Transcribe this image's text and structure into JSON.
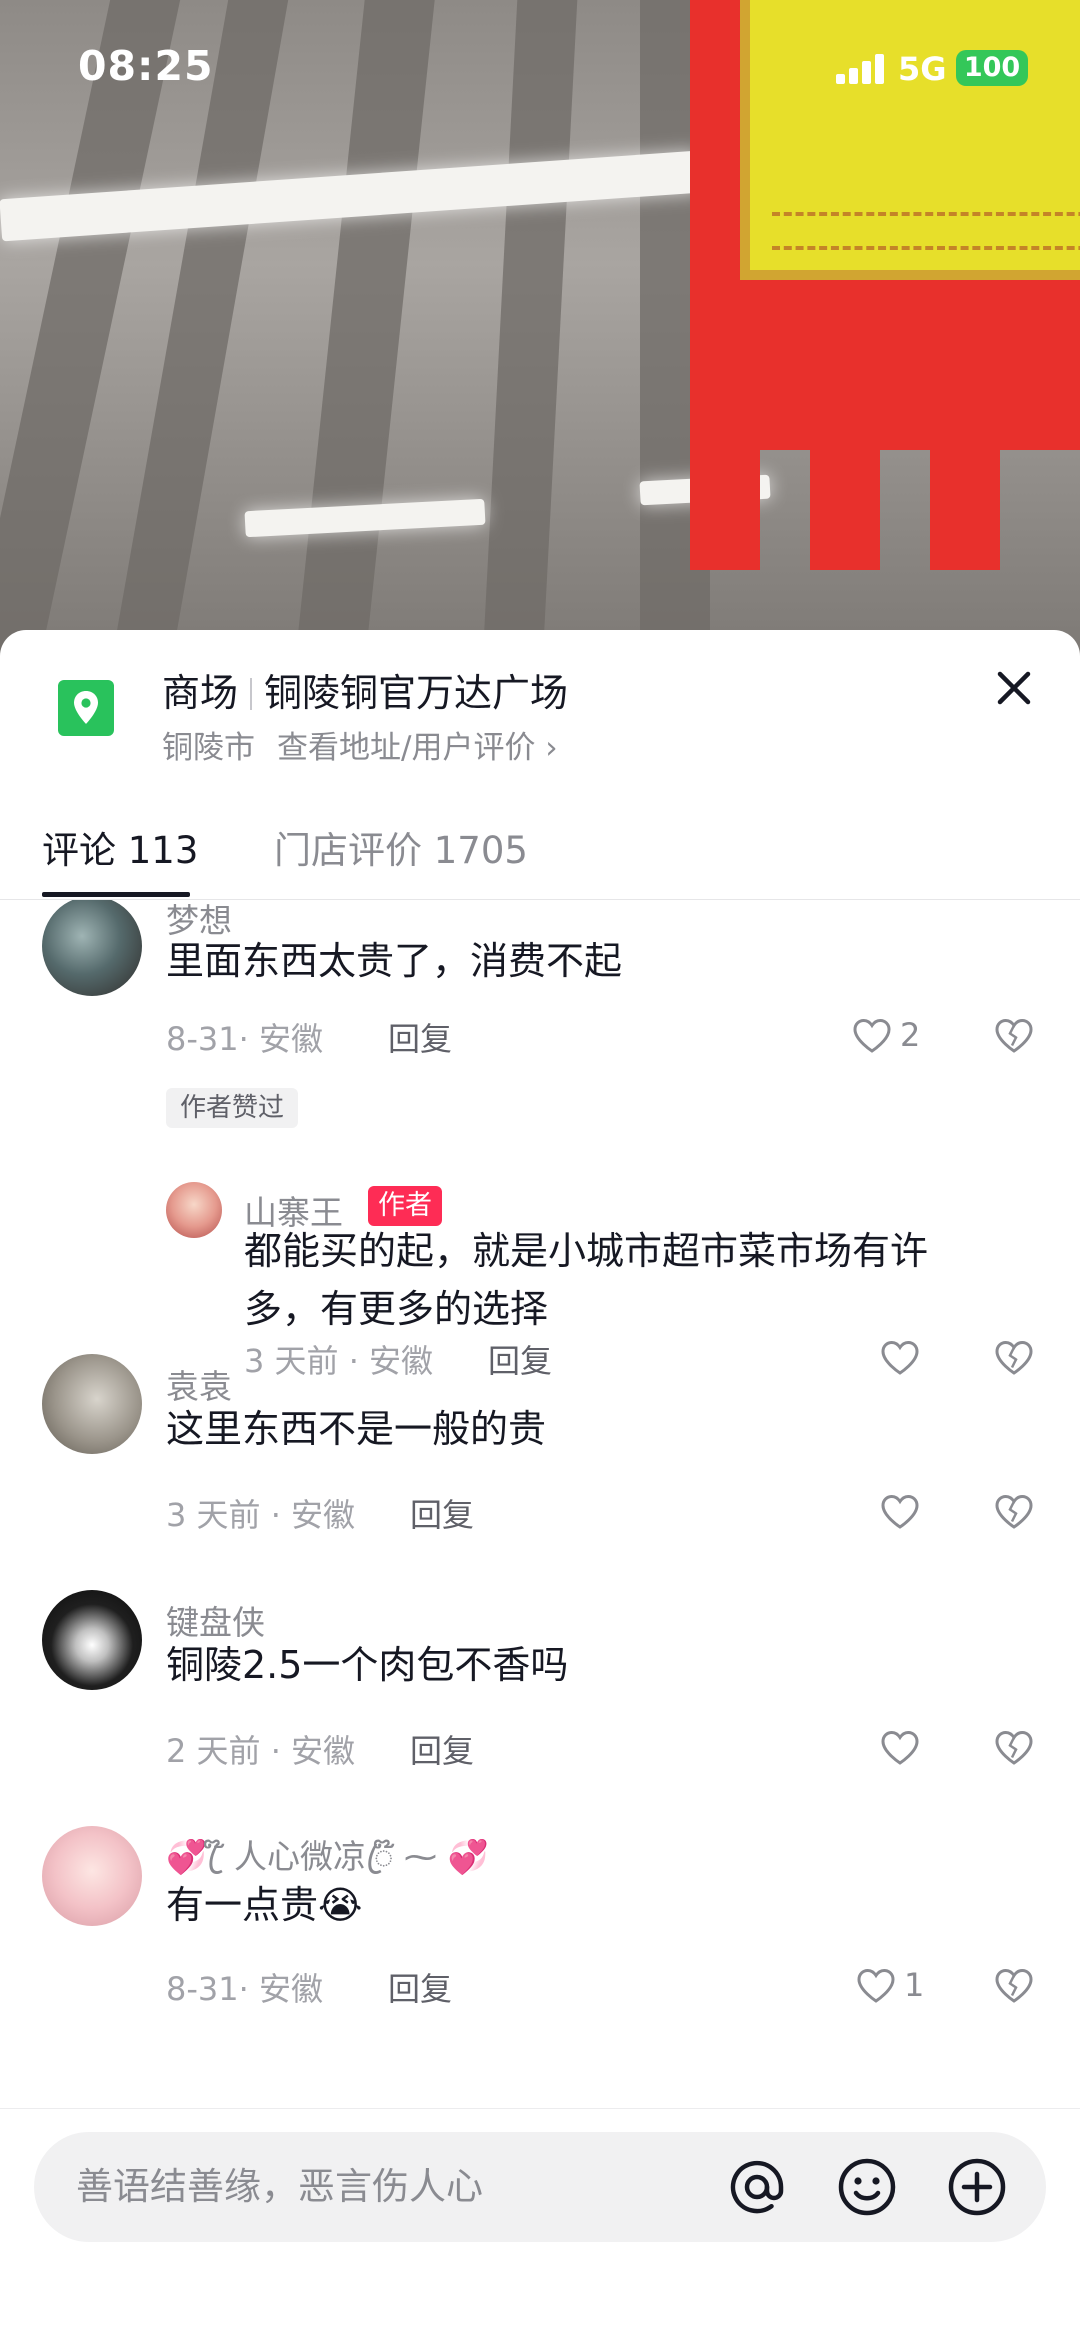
{
  "status_bar": {
    "time": "08:25",
    "network": "5G",
    "battery": "100"
  },
  "location": {
    "category": "商场",
    "name": "铜陵铜官万达广场",
    "city": "铜陵市",
    "link": "查看地址/用户评价 ›"
  },
  "tabs": [
    {
      "label": "评论 113",
      "active": true
    },
    {
      "label": "门店评价 1705",
      "active": false
    }
  ],
  "comments": [
    {
      "user": "梦想",
      "text": "里面东西太贵了，消费不起",
      "meta": "8-31· 安徽",
      "reply_label": "回复",
      "likes": "2",
      "badge": "作者赞过",
      "replies": [
        {
          "user": "山寨王",
          "author_tag": "作者",
          "text_line1": "都能买的起，就是小城市超市菜市场有许",
          "text_line2": "多，有更多的选择",
          "meta": "3 天前 · 安徽",
          "reply_label": "回复"
        }
      ]
    },
    {
      "user": "袁袁",
      "text": "这里东西不是一般的贵",
      "meta": "3 天前 · 安徽",
      "reply_label": "回复"
    },
    {
      "user": "键盘侠",
      "text": "铜陵2.5一个肉包不香吗",
      "meta": "2 天前 · 安徽",
      "reply_label": "回复"
    },
    {
      "user": "💞 ꦿ໊ 人心微凉ꦿ໊ ⁓ 💞",
      "text": "有一点贵😭",
      "meta": "8-31· 安徽",
      "reply_label": "回复",
      "likes": "1"
    }
  ],
  "input": {
    "placeholder": "善语结善缘，恶言伤人心"
  },
  "icons": [
    "location-pin-icon",
    "close-icon",
    "heart-icon",
    "dislike-heart-icon",
    "at-icon",
    "emoji-icon",
    "plus-icon"
  ],
  "colors": {
    "accent_red": "#fe2c55",
    "location_green": "#29c25c"
  }
}
